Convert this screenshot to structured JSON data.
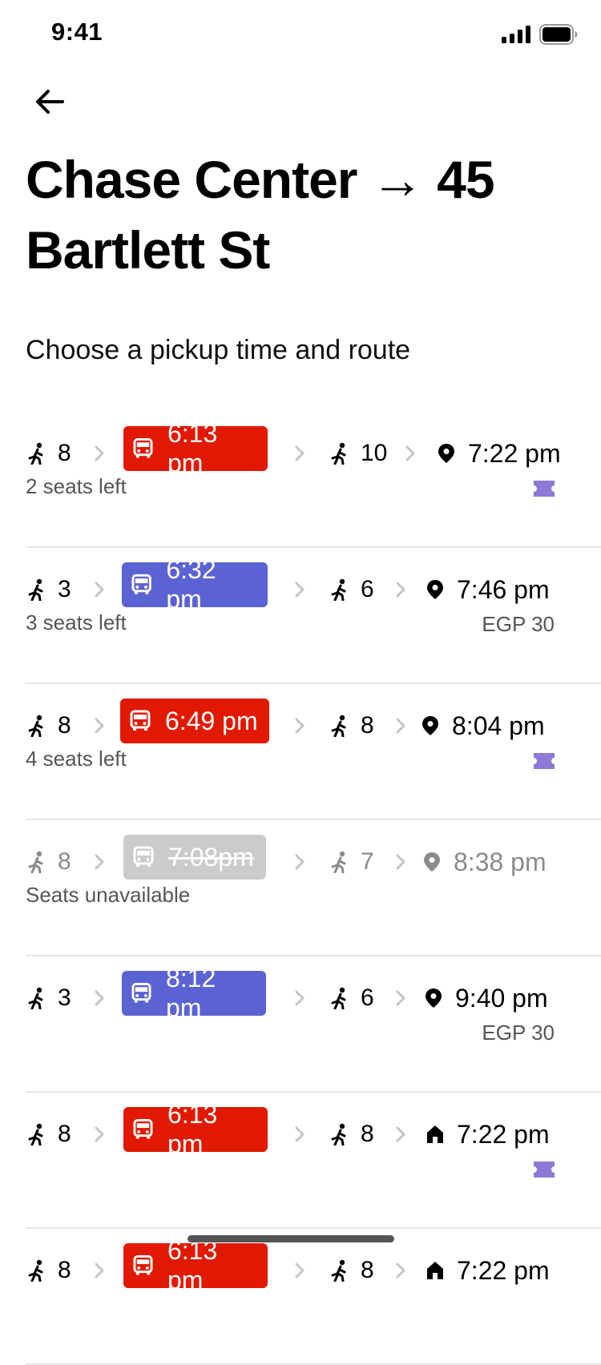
{
  "status_bar": {
    "time": "9:41"
  },
  "header": {
    "title": "Chase Center → 45 Bartlett St",
    "subtitle": "Choose a pickup time and route"
  },
  "colors": {
    "red": "#e11900",
    "blue": "#5b63d3",
    "disabled": "#cbcbcb",
    "ticket": "#8c7ad6"
  },
  "trips": [
    {
      "walk_before": "8",
      "bus_time": "6:13 pm",
      "bus_color": "red",
      "walk_after": "10",
      "arrival": "7:22 pm",
      "arrival_icon": "location-pin-icon",
      "seats": "2 seats left",
      "price": "",
      "ticket": true,
      "disabled": false
    },
    {
      "walk_before": "3",
      "bus_time": "6:32 pm",
      "bus_color": "blue",
      "walk_after": "6",
      "arrival": "7:46 pm",
      "arrival_icon": "location-pin-icon",
      "seats": "3 seats left",
      "price": "EGP 30",
      "ticket": false,
      "disabled": false
    },
    {
      "walk_before": "8",
      "bus_time": "6:49 pm",
      "bus_color": "red",
      "walk_after": "8",
      "arrival": "8:04 pm",
      "arrival_icon": "location-pin-icon",
      "seats": "4 seats left",
      "price": "",
      "ticket": true,
      "disabled": false
    },
    {
      "walk_before": "8",
      "bus_time": "7:08pm",
      "bus_color": "gray",
      "walk_after": "7",
      "arrival": "8:38 pm",
      "arrival_icon": "location-pin-icon",
      "seats": "Seats unavailable",
      "price": "",
      "ticket": false,
      "disabled": true
    },
    {
      "walk_before": "3",
      "bus_time": "8:12 pm",
      "bus_color": "blue",
      "walk_after": "6",
      "arrival": "9:40 pm",
      "arrival_icon": "location-pin-icon",
      "seats": "",
      "price": "EGP 30",
      "ticket": false,
      "disabled": false
    },
    {
      "walk_before": "8",
      "bus_time": "6:13 pm",
      "bus_color": "red",
      "walk_after": "8",
      "arrival": "7:22 pm",
      "arrival_icon": "home-icon",
      "seats": "",
      "price": "",
      "ticket": true,
      "disabled": false
    },
    {
      "walk_before": "8",
      "bus_time": "6:13 pm",
      "bus_color": "red",
      "walk_after": "8",
      "arrival": "7:22 pm",
      "arrival_icon": "home-icon",
      "seats": "",
      "price": "",
      "ticket": false,
      "disabled": false
    }
  ]
}
